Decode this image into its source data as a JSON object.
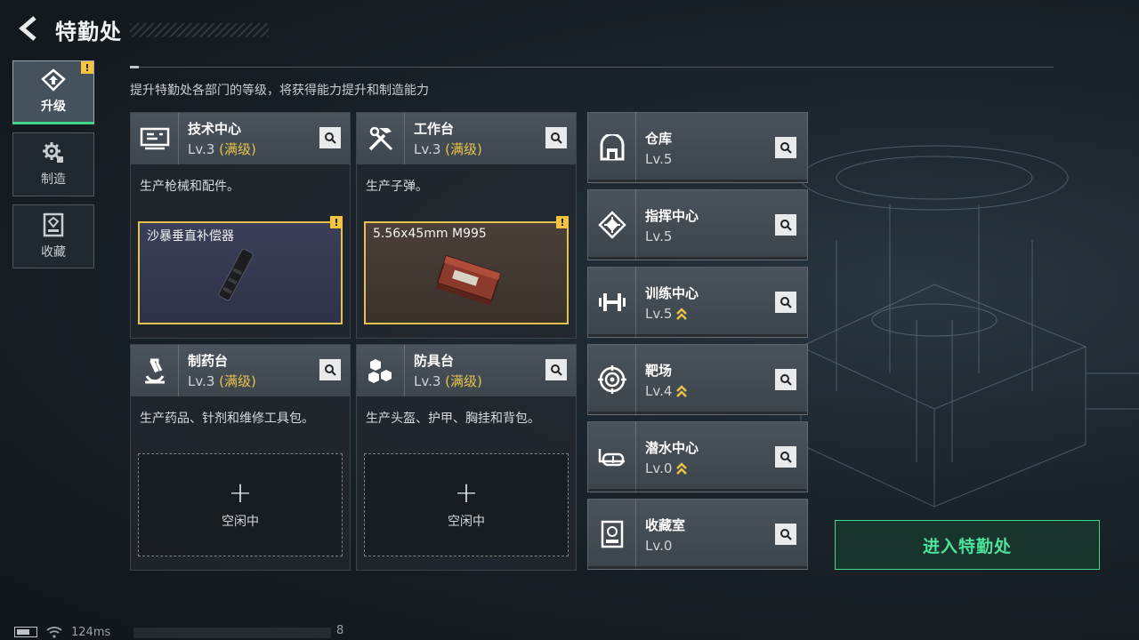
{
  "header": {
    "title": "特勤处"
  },
  "sidenav": {
    "items": [
      {
        "label": "升级",
        "active": true,
        "badge": "!"
      },
      {
        "label": "制造",
        "active": false
      },
      {
        "label": "收藏",
        "active": false
      }
    ]
  },
  "description": "提升特勤处各部门的等级，将获得能力提升和制造能力",
  "production": [
    {
      "name": "技术中心",
      "level": "Lv.3",
      "maxed": "(满级)",
      "desc": "生产枪械和配件。",
      "slot": {
        "item": "沙暴垂直补偿器",
        "badge": "!"
      }
    },
    {
      "name": "工作台",
      "level": "Lv.3",
      "maxed": "(满级)",
      "desc": "生产子弹。",
      "slot": {
        "item": "5.56x45mm M995",
        "badge": "!"
      }
    },
    {
      "name": "制药台",
      "level": "Lv.3",
      "maxed": "(满级)",
      "desc": "生产药品、针剂和维修工具包。",
      "slot": {
        "empty_label": "空闲中"
      }
    },
    {
      "name": "防具台",
      "level": "Lv.3",
      "maxed": "(满级)",
      "desc": "生产头盔、护甲、胸挂和背包。",
      "slot": {
        "empty_label": "空闲中"
      }
    }
  ],
  "facilities": [
    {
      "name": "仓库",
      "level": "Lv.5",
      "upgradable": false,
      "icon": "warehouse-icon"
    },
    {
      "name": "指挥中心",
      "level": "Lv.5",
      "upgradable": false,
      "icon": "chip-icon"
    },
    {
      "name": "训练中心",
      "level": "Lv.5",
      "upgradable": true,
      "icon": "dumbbell-icon"
    },
    {
      "name": "靶场",
      "level": "Lv.4",
      "upgradable": true,
      "icon": "target-icon"
    },
    {
      "name": "潜水中心",
      "level": "Lv.0",
      "upgradable": true,
      "icon": "goggles-icon"
    },
    {
      "name": "收藏室",
      "level": "Lv.0",
      "upgradable": false,
      "icon": "collection-icon"
    }
  ],
  "enter_button": "进入特勤处",
  "status": {
    "ping": "124ms",
    "value": "8"
  },
  "colors": {
    "accent_green": "#3fd68a",
    "maxed_gold": "#e8c24a",
    "badge_yellow": "#f3c43c"
  }
}
